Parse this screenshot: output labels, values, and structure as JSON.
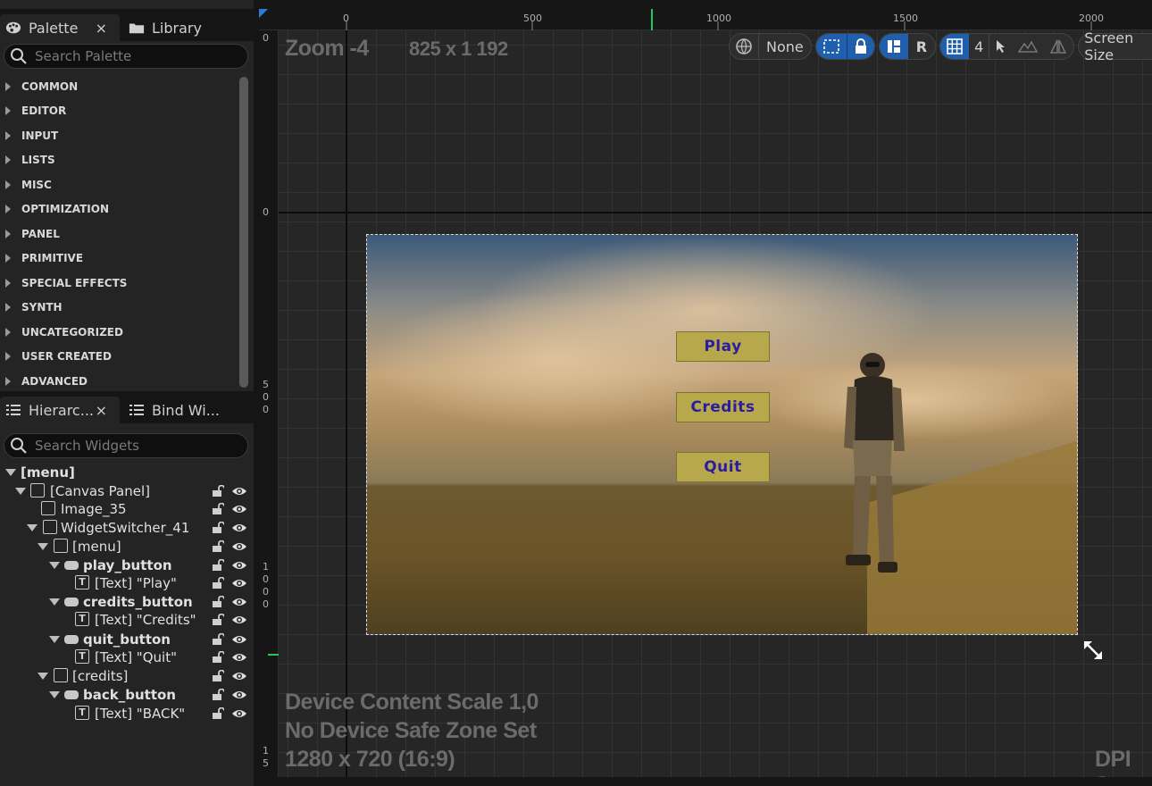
{
  "palette": {
    "tabs": [
      {
        "label": "Palette",
        "close": "×"
      },
      {
        "label": "Library"
      }
    ],
    "search_placeholder": "Search Palette",
    "categories": [
      "COMMON",
      "EDITOR",
      "INPUT",
      "LISTS",
      "MISC",
      "OPTIMIZATION",
      "PANEL",
      "PRIMITIVE",
      "SPECIAL EFFECTS",
      "SYNTH",
      "UNCATEGORIZED",
      "USER CREATED",
      "ADVANCED"
    ]
  },
  "hierarchy": {
    "tabs": [
      {
        "label": "Hierarc...",
        "close": "×"
      },
      {
        "label": "Bind Wi..."
      }
    ],
    "search_placeholder": "Search Widgets",
    "root": "[menu]",
    "items": [
      {
        "label": "[Canvas Panel]"
      },
      {
        "label": "Image_35"
      },
      {
        "label": "WidgetSwitcher_41"
      },
      {
        "label": "[menu]"
      },
      {
        "label": "play_button"
      },
      {
        "label": "[Text] \"Play\""
      },
      {
        "label": "credits_button"
      },
      {
        "label": "[Text] \"Credits\""
      },
      {
        "label": "quit_button"
      },
      {
        "label": "[Text] \"Quit\""
      },
      {
        "label": "[credits]"
      },
      {
        "label": "back_button"
      },
      {
        "label": "[Text] \"BACK\""
      }
    ]
  },
  "designer": {
    "zoom": "Zoom -4",
    "resolution_readout": "825 x 1 192",
    "ruler_top": [
      "0",
      "500",
      "1000",
      "1500",
      "2000"
    ],
    "ruler_left": [
      "0",
      "0",
      "5\n0\n0",
      "1\n0\n0\n0",
      "1\n5"
    ],
    "toolbar": {
      "globe_label": "None",
      "r_label": "R",
      "grid_value": "4",
      "screen_size": "Screen Size"
    },
    "info_lines": [
      "Device Content Scale 1,0",
      "No Device Safe Zone Set",
      "1280 x 720 (16:9)"
    ],
    "dpi_label": "DPI Sc"
  },
  "game_menu": {
    "buttons": [
      "Play",
      "Credits",
      "Quit"
    ],
    "button_color": "#b7a94b",
    "text_color": "#2b1da0"
  },
  "colors": {
    "selection_blue": "#1f5fae",
    "panel_bg": "#242424",
    "canvas_bg": "#262626"
  }
}
